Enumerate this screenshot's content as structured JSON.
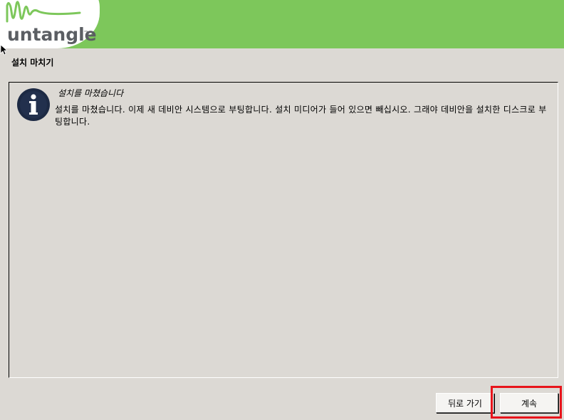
{
  "logo": {
    "text": "untangle",
    "tm": "™"
  },
  "page": {
    "title": "설치 마치기"
  },
  "message": {
    "heading": "설치를 마쳤습니다",
    "body": "설치를 마쳤습니다. 이제 새 데비안 시스템으로 부팅합니다. 설치 미디어가 들어 있으면 빼십시오. 그래야 데비안을 설치한 디스크로 부팅합니다."
  },
  "buttons": {
    "back": "뒤로 가기",
    "continue": "계속"
  },
  "colors": {
    "header_green": "#7dc75b",
    "background": "#dcd9d4",
    "highlight": "#e8141b",
    "icon_dark": "#1d2a44"
  }
}
